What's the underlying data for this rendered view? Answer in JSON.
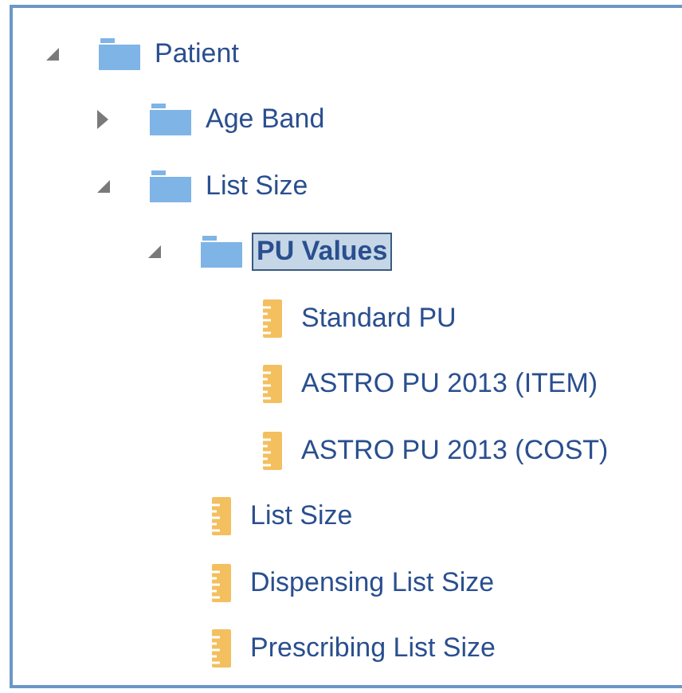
{
  "tree": [
    {
      "kind": "folder",
      "label": "Patient",
      "expanded": true,
      "selected": false,
      "children": [
        {
          "kind": "folder",
          "label": "Age Band",
          "expanded": false,
          "selected": false
        },
        {
          "kind": "folder",
          "label": "List Size",
          "expanded": true,
          "selected": false,
          "children": [
            {
              "kind": "folder",
              "label": "PU Values",
              "expanded": true,
              "selected": true,
              "children": [
                {
                  "kind": "measure",
                  "label": "Standard PU",
                  "selected": false
                },
                {
                  "kind": "measure",
                  "label": "ASTRO PU 2013 (ITEM)",
                  "selected": false
                },
                {
                  "kind": "measure",
                  "label": "ASTRO PU 2013 (COST)",
                  "selected": false
                }
              ]
            },
            {
              "kind": "measure",
              "label": "List Size",
              "selected": false
            },
            {
              "kind": "measure",
              "label": "Dispensing List Size",
              "selected": false
            },
            {
              "kind": "measure",
              "label": "Prescribing List Size",
              "selected": false
            }
          ]
        }
      ]
    }
  ]
}
